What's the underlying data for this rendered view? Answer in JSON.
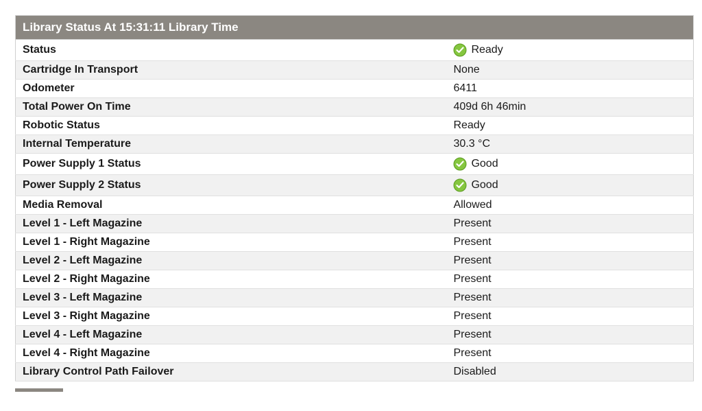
{
  "header": {
    "title": "Library Status At 15:31:11 Library Time"
  },
  "sections": [
    {
      "rows": [
        {
          "label": "Status",
          "value": "Ready",
          "icon": "check"
        },
        {
          "label": "Cartridge In Transport",
          "value": "None",
          "icon": null
        },
        {
          "label": "Odometer",
          "value": "6411",
          "icon": null
        },
        {
          "label": "Total Power On Time",
          "value": "409d 6h 46min",
          "icon": null
        },
        {
          "label": "Robotic Status",
          "value": "Ready",
          "icon": null
        },
        {
          "label": "Internal Temperature",
          "value": "30.3 °C",
          "icon": null
        },
        {
          "label": "Power Supply 1 Status",
          "value": "Good",
          "icon": "check"
        },
        {
          "label": "Power Supply 2 Status",
          "value": "Good",
          "icon": "check"
        }
      ]
    },
    {
      "rows": [
        {
          "label": "Media Removal",
          "value": "Allowed",
          "icon": null
        },
        {
          "label": "Level 1 - Left Magazine",
          "value": "Present",
          "icon": null
        },
        {
          "label": "Level 1 - Right Magazine",
          "value": "Present",
          "icon": null
        },
        {
          "label": "Level 2 - Left Magazine",
          "value": "Present",
          "icon": null
        },
        {
          "label": "Level 2 - Right Magazine",
          "value": "Present",
          "icon": null
        },
        {
          "label": "Level 3 - Left Magazine",
          "value": "Present",
          "icon": null
        },
        {
          "label": "Level 3 - Right Magazine",
          "value": "Present",
          "icon": null
        },
        {
          "label": "Level 4 - Left Magazine",
          "value": "Present",
          "icon": null
        },
        {
          "label": "Level 4 - Right Magazine",
          "value": "Present",
          "icon": null
        },
        {
          "label": "Library Control Path Failover",
          "value": "Disabled",
          "icon": null
        }
      ]
    }
  ],
  "colors": {
    "check_fill": "#85c63f",
    "check_stroke": "#5a9a1f"
  }
}
